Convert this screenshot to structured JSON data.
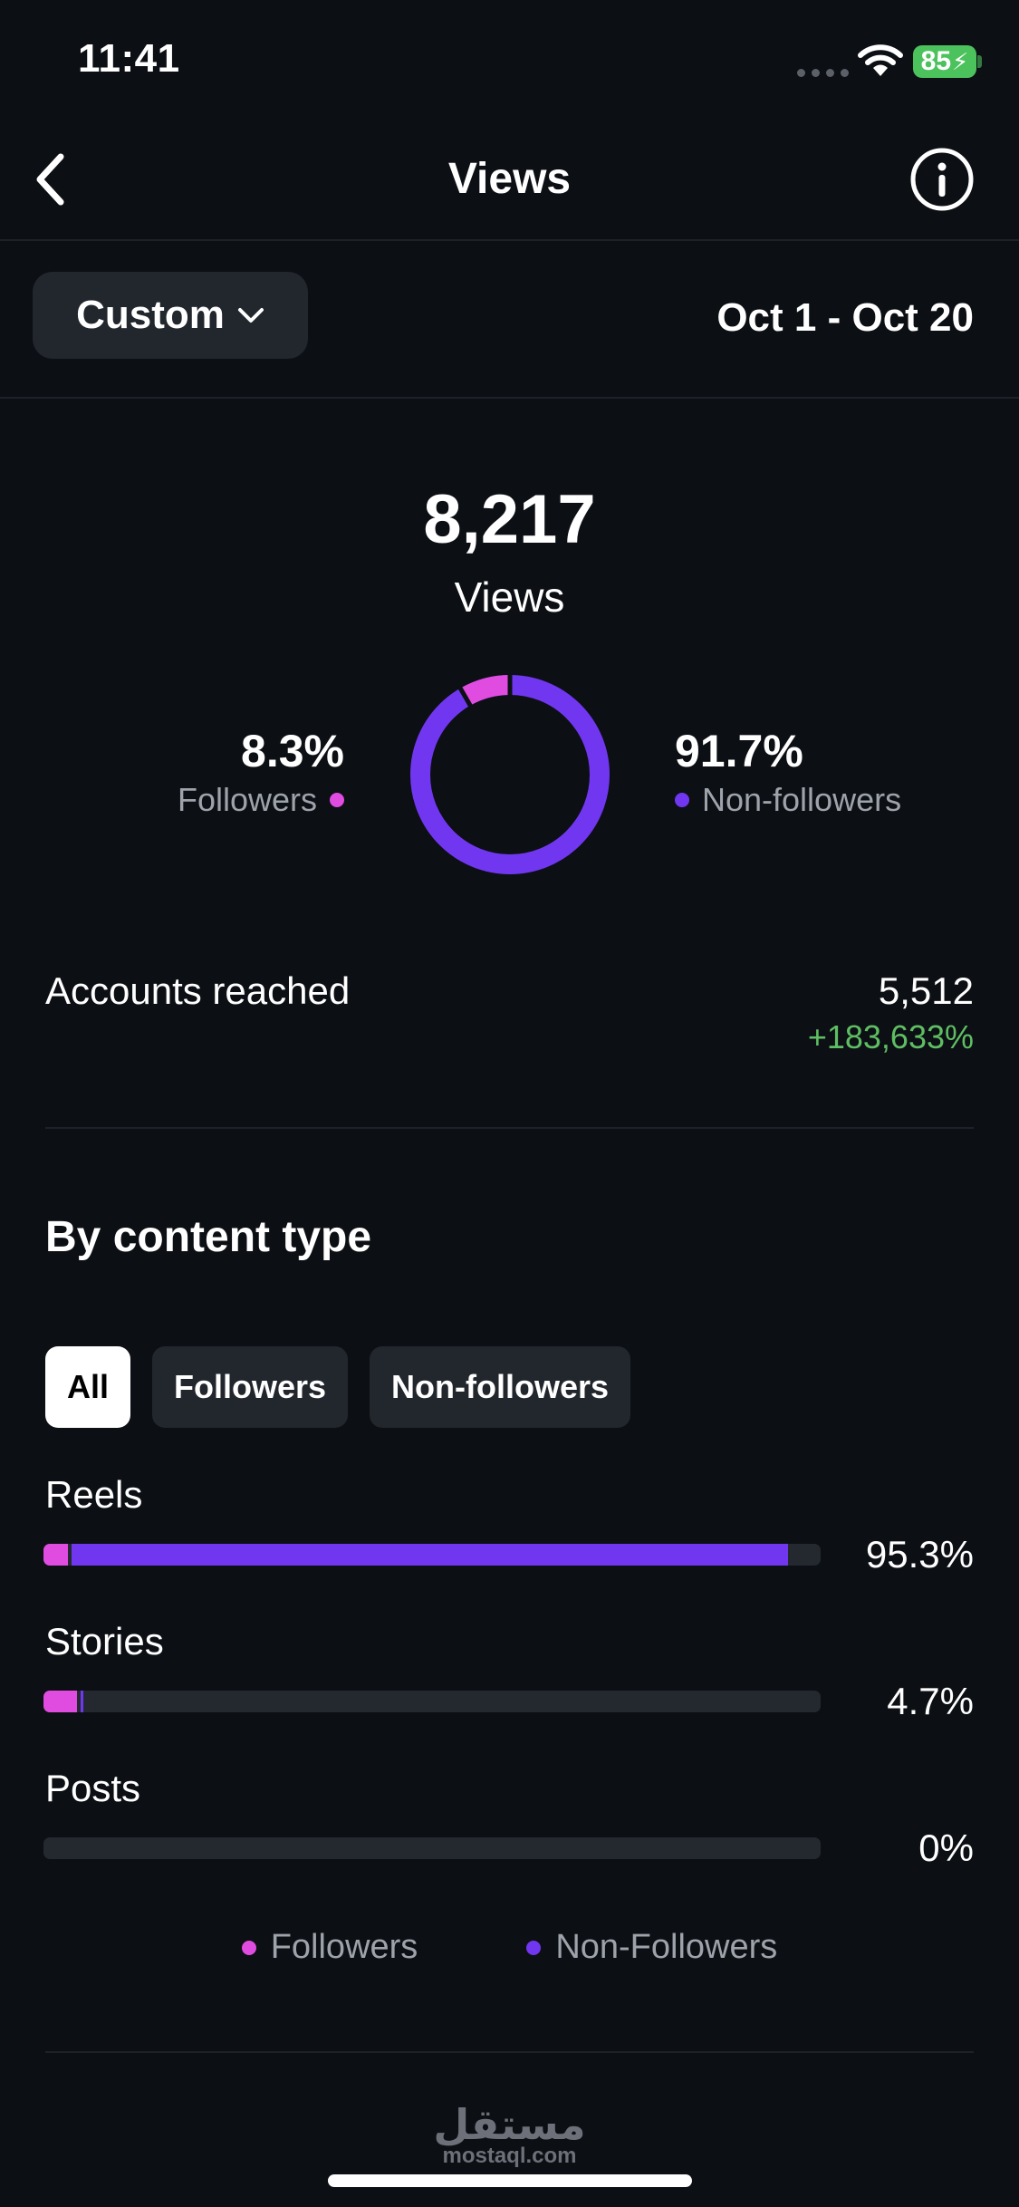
{
  "status": {
    "time": "11:41",
    "battery": "85"
  },
  "header": {
    "title": "Views"
  },
  "filter": {
    "range_label": "Custom",
    "date_range": "Oct 1 - Oct 20"
  },
  "summary": {
    "total_value": "8,217",
    "total_label": "Views",
    "followers_pct": "8.3%",
    "followers_label": "Followers",
    "nonfollowers_pct": "91.7%",
    "nonfollowers_label": "Non-followers",
    "donut_followers_fraction": 0.083
  },
  "accounts": {
    "label": "Accounts reached",
    "value": "5,512",
    "change": "+183,633%"
  },
  "content_type": {
    "title": "By content type",
    "tabs": [
      "All",
      "Followers",
      "Non-followers"
    ],
    "active_tab": 0,
    "rows": [
      {
        "label": "Reels",
        "value": "95.3%",
        "followers_fraction": 0.031,
        "nonfollowers_fraction": 0.922
      },
      {
        "label": "Stories",
        "value": "4.7%",
        "followers_fraction": 0.043,
        "nonfollowers_fraction": 0.004
      },
      {
        "label": "Posts",
        "value": "0%",
        "followers_fraction": 0,
        "nonfollowers_fraction": 0
      }
    ],
    "legend": [
      "Followers",
      "Non-Followers"
    ]
  },
  "colors": {
    "followers": "#e04ce0",
    "nonfollowers": "#7137f0",
    "positive": "#5fbe63",
    "battery": "#4cc25d"
  },
  "watermark": {
    "logo": "مستقل",
    "text": "mostaql.com"
  }
}
